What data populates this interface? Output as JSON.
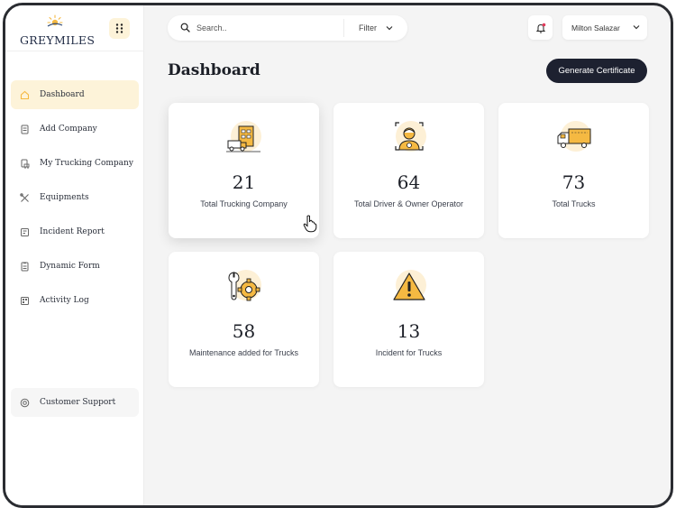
{
  "app": {
    "logo_text": "GREYMILES"
  },
  "sidebar": {
    "items": [
      {
        "label": "Dashboard",
        "icon": "home-icon",
        "active": true
      },
      {
        "label": "Add Company",
        "icon": "document-icon",
        "active": false
      },
      {
        "label": "My Trucking Company",
        "icon": "truck-document-icon",
        "active": false
      },
      {
        "label": "Equipments",
        "icon": "tools-icon",
        "active": false
      },
      {
        "label": "Incident Report",
        "icon": "report-icon",
        "active": false
      },
      {
        "label": "Dynamic Form",
        "icon": "form-icon",
        "active": false
      },
      {
        "label": "Activity Log",
        "icon": "log-icon",
        "active": false
      }
    ],
    "support_label": "Customer Support"
  },
  "header": {
    "search_placeholder": "Search..",
    "filter_label": "Filter",
    "user_name": "Milton Salazar"
  },
  "main": {
    "title": "Dashboard",
    "generate_label": "Generate Certificate",
    "cards": [
      {
        "value": "21",
        "label": "Total Trucking Company",
        "icon": "trucking-company-icon"
      },
      {
        "value": "64",
        "label": "Total Driver & Owner Operator",
        "icon": "driver-icon"
      },
      {
        "value": "73",
        "label": "Total Trucks",
        "icon": "truck-icon"
      },
      {
        "value": "58",
        "label": "Maintenance added for Trucks",
        "icon": "maintenance-icon"
      },
      {
        "value": "13",
        "label": "Incident for Trucks",
        "icon": "warning-icon"
      }
    ]
  },
  "colors": {
    "accent": "#f5b942",
    "accent_soft": "#fdf0d6",
    "primary_button": "#1d2130",
    "notification_dot": "#e23b5b"
  }
}
